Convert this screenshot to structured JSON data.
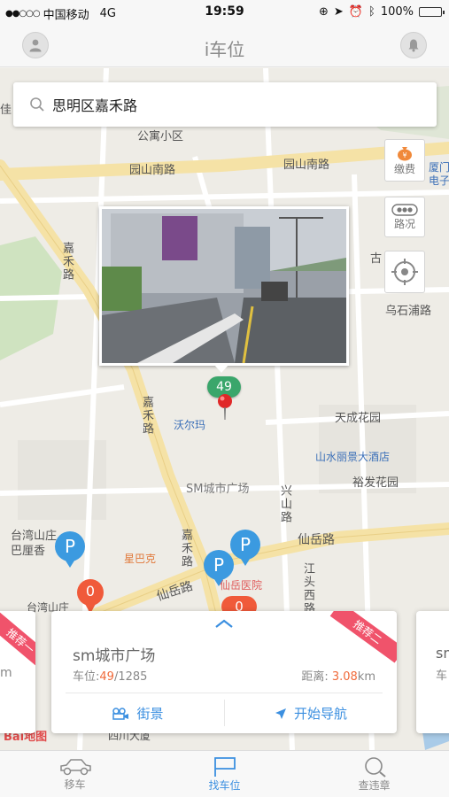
{
  "status_bar": {
    "carrier": "中国移动",
    "network": "4G",
    "time": "19:59",
    "battery": "100%"
  },
  "nav": {
    "title": "i车位"
  },
  "search": {
    "value": "思明区嘉禾路"
  },
  "tools": {
    "pay_label": "缴费",
    "traffic_label": "路况"
  },
  "map_labels": {
    "gongyu": "公寓小区",
    "yuanshan_s": "园山南路",
    "yuanshan": "园山南路",
    "xiamen": "厦门",
    "dianzi": "电子",
    "gu": "古",
    "wushipu": "乌石浦路",
    "jiahe_top": "嘉禾路",
    "jiahe_mid": "嘉禾路",
    "jiahe_low": "嘉禾路",
    "walmart": "沃尔玛",
    "tiancheng": "天成花园",
    "hotel": "山水丽景大酒店",
    "yufa": "裕发花园",
    "sm_plaza": "SM城市广场",
    "xing": "兴山路",
    "taiwan": "台湾山庄",
    "balixiang": "巴厘香",
    "starbucks": "星巴克",
    "xianyue_r": "仙岳路",
    "xianyue_l": "仙岳路",
    "hospital": "仙岳医院",
    "jiangtou": "江头西路",
    "taiwan2": "台湾山庄",
    "sichuan": "四川大厦",
    "left_edge": "佳"
  },
  "markers": {
    "photo_count": "49",
    "red1": "0",
    "red2": "0",
    "parking": "P"
  },
  "card": {
    "name": "sm城市广场",
    "spots_label": "车位:",
    "spots_free": "49",
    "spots_total": "/1285",
    "distance_label": "距离:",
    "distance_value": "3.08",
    "distance_unit": "km",
    "street_view": "街景",
    "navigate": "开始导航",
    "ribbon_right": "推荐二",
    "ribbon_left": "推荐一"
  },
  "side_card_right": {
    "name": "sm",
    "spots_label": "车"
  },
  "side_card_left": {
    "unit": "m"
  },
  "map_brand": "Bai地图",
  "tabs": [
    {
      "label": "移车"
    },
    {
      "label": "找车位"
    },
    {
      "label": "查违章"
    }
  ],
  "colors": {
    "accent": "#3b8fe0",
    "highlight": "#f06a3a",
    "ribbon": "#f0536b",
    "marker_green": "#3aa66b",
    "marker_red": "#f05a3a"
  }
}
